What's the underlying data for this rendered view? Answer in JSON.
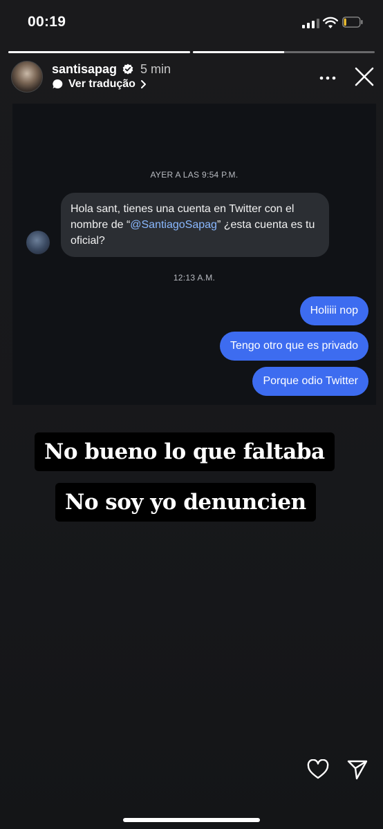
{
  "status_bar": {
    "time": "00:19",
    "signal_bars": 3,
    "battery_level": 0.15
  },
  "story_progress": [
    1.0,
    0.5
  ],
  "header": {
    "username": "santisapag",
    "time_ago": "5 min",
    "translate_label": "Ver tradução"
  },
  "screenshot": {
    "timestamp1": "AYER A LAS 9:54 P.M.",
    "incoming_parts": {
      "before": "Hola sant, tienes una cuenta en Twitter con el nombre de “",
      "handle": "@SantiagoSapag",
      "after": "” ¿esta cuenta es tu oficial?"
    },
    "timestamp2": "12:13 A.M.",
    "outgoing": [
      "Holiiii nop",
      "Tengo otro que es privado",
      "Porque odio Twitter"
    ]
  },
  "captions": [
    "No bueno lo que faltaba",
    "No soy yo denuncien"
  ],
  "colors": {
    "bubble_outgoing": "#3d6cf0",
    "bubble_incoming": "#2b2e33",
    "handle_link": "#8ab8ff"
  },
  "icons": [
    "signal-icon",
    "wifi-icon",
    "battery-icon",
    "verified-badge-icon",
    "translate-icon",
    "chevron-right-icon",
    "more-icon",
    "close-icon",
    "heart-icon",
    "send-icon"
  ]
}
